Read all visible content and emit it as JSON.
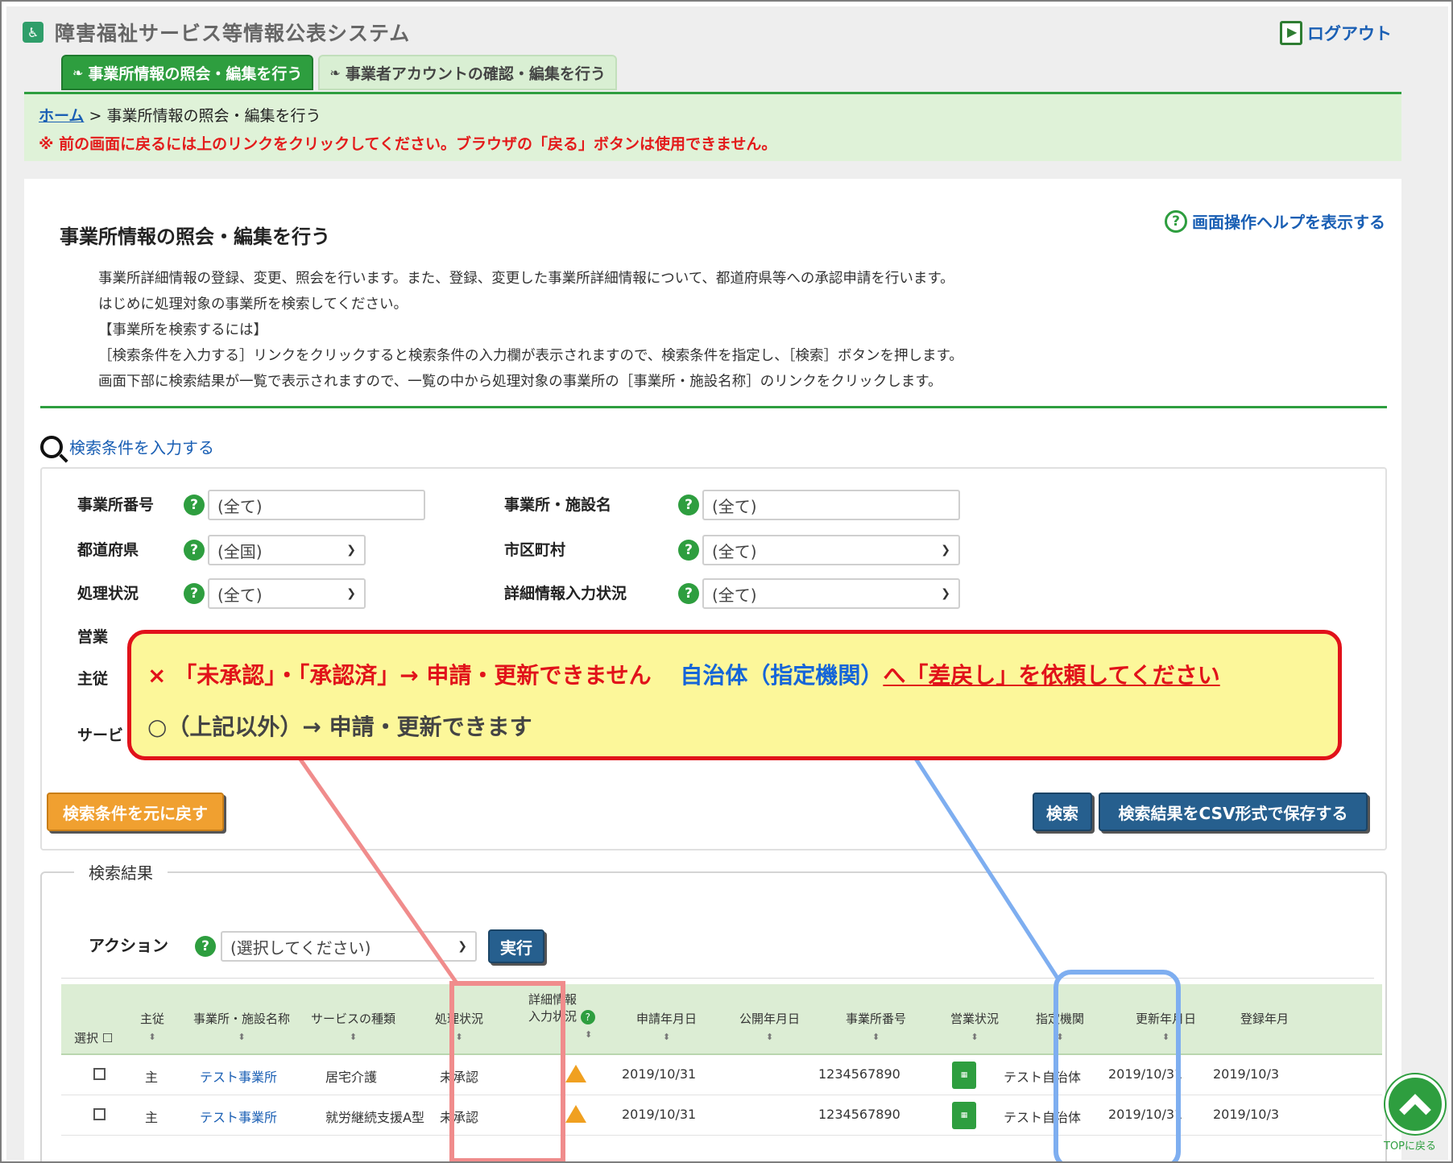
{
  "header": {
    "system_title": "障害福祉サービス等情報公表システム",
    "logout": "ログアウト",
    "logo_icon": "accessibility-icon"
  },
  "tabs": [
    {
      "label": "事業所情報の照会・編集を行う",
      "active": true
    },
    {
      "label": "事業者アカウントの確認・編集を行う",
      "active": false
    }
  ],
  "breadcrumb": {
    "home": "ホーム",
    "separator": ">",
    "current": "事業所情報の照会・編集を行う",
    "warning": "※ 前の画面に戻るには上のリンクをクリックしてください。ブラウザの「戻る」ボタンは使用できません。"
  },
  "main": {
    "help_link": "画面操作ヘルプを表示する",
    "page_title": "事業所情報の照会・編集を行う",
    "description": [
      "事業所詳細情報の登録、変更、照会を行います。また、登録、変更した事業所詳細情報について、都道府県等への承認申請を行います。",
      "はじめに処理対象の事業所を検索してください。",
      "【事業所を検索するには】",
      "［検索条件を入力する］リンクをクリックすると検索条件の入力欄が表示されますので、検索条件を指定し、［検索］ボタンを押します。",
      "画面下部に検索結果が一覧で表示されますので、一覧の中から処理対象の事業所の［事業所・施設名称］のリンクをクリックします。"
    ]
  },
  "search": {
    "toggle": "検索条件を入力する",
    "fields": {
      "office_number": {
        "label": "事業所番号",
        "value": "(全て)"
      },
      "facility_name": {
        "label": "事業所・施設名",
        "value": "(全て)"
      },
      "prefecture": {
        "label": "都道府県",
        "value": "(全国)"
      },
      "city": {
        "label": "市区町村",
        "value": "(全て)"
      },
      "process_status": {
        "label": "処理状況",
        "value": "(全て)"
      },
      "detail_status": {
        "label": "詳細情報入力状況",
        "value": "(全て)"
      },
      "business_status": {
        "label": "営業"
      },
      "main_sub": {
        "label": "主従"
      },
      "service": {
        "label": "サービ"
      }
    },
    "reset_button": "検索条件を元に戻す",
    "search_button": "検索",
    "csv_button": "検索結果をCSV形式で保存する"
  },
  "results": {
    "legend": "検索結果",
    "action_label": "アクション",
    "action_select": "(選択してください)",
    "execute_button": "実行",
    "columns": {
      "select": "選択",
      "main_sub": "主従",
      "facility": "事業所・施設名称",
      "service": "サービスの種類",
      "process": "処理状況",
      "detail_1": "詳細情報",
      "detail_2": "入力状況",
      "apply_date": "申請年月日",
      "publish_date": "公開年月日",
      "office_no": "事業所番号",
      "business": "営業状況",
      "agency": "指定機関",
      "update_date": "更新年月日",
      "register_date": "登録年月"
    },
    "rows": [
      {
        "main_sub": "主",
        "facility": "テスト事業所",
        "service": "居宅介護",
        "process": "未承認",
        "apply_date": "2019/10/31",
        "office_no": "1234567890",
        "agency": "テスト自治体",
        "update_date": "2019/10/31",
        "register_date": "2019/10/3"
      },
      {
        "main_sub": "主",
        "facility": "テスト事業所",
        "service": "就労継続支援A型",
        "process": "未承認",
        "apply_date": "2019/10/31",
        "office_no": "1234567890",
        "agency": "テスト自治体",
        "update_date": "2019/10/31",
        "register_date": "2019/10/3"
      }
    ]
  },
  "callout": {
    "line1_red": "× 「未承認」・「承認済」→ 申請・更新できません",
    "line1_blue": "自治体（指定機関）",
    "line1_tail_a": "へ「差戻し」を依頼し",
    "line1_tail_b": "てください",
    "line2": "○（上記以外）→ 申請・更新できます"
  },
  "top_button": "TOPに戻る",
  "colors": {
    "brand_green": "#2e9e3f",
    "callout_red": "#e1121a",
    "callout_yellow": "#fcf79a",
    "link_blue": "#1a5fb4",
    "highlight_red": "#f08c8c",
    "highlight_blue": "#7eaef0"
  }
}
